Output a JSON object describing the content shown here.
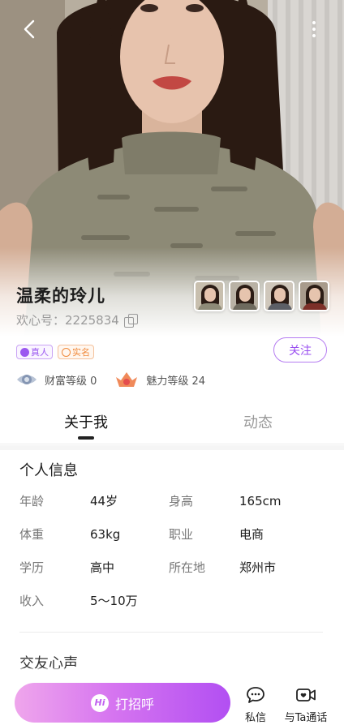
{
  "profile": {
    "name": "温柔的玲儿",
    "uid_label": "欢心号：2225834",
    "badges": {
      "real": "真人",
      "realname": "实名"
    },
    "follow_label": "关注",
    "wealth_level": "财富等级 0",
    "charm_level": "魅力等级 24"
  },
  "tabs": [
    {
      "label": "关于我",
      "active": true
    },
    {
      "label": "动态",
      "active": false
    }
  ],
  "info": {
    "title": "个人信息",
    "rows": [
      [
        {
          "k": "年龄",
          "v": "44岁"
        },
        {
          "k": "身高",
          "v": "165cm"
        }
      ],
      [
        {
          "k": "体重",
          "v": "63kg"
        },
        {
          "k": "职业",
          "v": "电商"
        }
      ],
      [
        {
          "k": "学历",
          "v": "高中"
        },
        {
          "k": "所在地",
          "v": "郑州市"
        }
      ],
      [
        {
          "k": "收入",
          "v": "5～10万"
        }
      ]
    ]
  },
  "voice_title": "交友心声",
  "bottom": {
    "call_label": "打招呼",
    "call_icon_text": "Hi",
    "message_label": "私信",
    "video_label": "与Ta通话"
  },
  "colors": {
    "accent": "#b24ff2",
    "follow_border": "#b57cf1",
    "badge_real": "#9b58f0",
    "badge_realname": "#f08a3c"
  },
  "icons": {
    "back": "chevron-left-icon",
    "more": "more-vertical-icon",
    "copy": "copy-icon",
    "wealth": "wealth-level-icon",
    "charm": "charm-level-icon",
    "message": "chat-bubble-icon",
    "video": "video-call-icon"
  }
}
